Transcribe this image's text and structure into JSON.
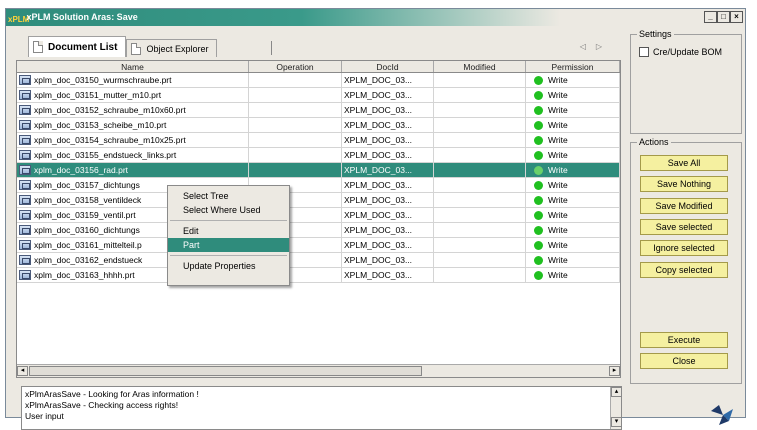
{
  "window": {
    "title": "xPLM Solution Aras: Save",
    "app_icon": "xPLM",
    "minimize": "_",
    "maximize": "□",
    "close": "×"
  },
  "tabs": [
    {
      "label": "Document List",
      "active": true
    },
    {
      "label": "Object Explorer",
      "active": false
    }
  ],
  "tab_nav": {
    "prev": "◁",
    "next": "▷"
  },
  "columns": [
    "Name",
    "Operation",
    "DocId",
    "Modified",
    "Permission"
  ],
  "rows": [
    {
      "name": "xplm_doc_03150_wurmschraube.prt",
      "operation": "",
      "docid": "XPLM_DOC_03...",
      "modified": "",
      "permission": "Write"
    },
    {
      "name": "xplm_doc_03151_mutter_m10.prt",
      "operation": "",
      "docid": "XPLM_DOC_03...",
      "modified": "",
      "permission": "Write"
    },
    {
      "name": "xplm_doc_03152_schraube_m10x60.prt",
      "operation": "",
      "docid": "XPLM_DOC_03...",
      "modified": "",
      "permission": "Write"
    },
    {
      "name": "xplm_doc_03153_scheibe_m10.prt",
      "operation": "",
      "docid": "XPLM_DOC_03...",
      "modified": "",
      "permission": "Write"
    },
    {
      "name": "xplm_doc_03154_schraube_m10x25.prt",
      "operation": "",
      "docid": "XPLM_DOC_03...",
      "modified": "",
      "permission": "Write"
    },
    {
      "name": "xplm_doc_03155_endstueck_links.prt",
      "operation": "",
      "docid": "XPLM_DOC_03...",
      "modified": "",
      "permission": "Write"
    },
    {
      "name": "xplm_doc_03156_rad.prt",
      "operation": "",
      "docid": "XPLM_DOC_03...",
      "modified": "",
      "permission": "Write",
      "selected": true
    },
    {
      "name": "xplm_doc_03157_dichtungs",
      "operation": "",
      "docid": "XPLM_DOC_03...",
      "modified": "",
      "permission": "Write"
    },
    {
      "name": "xplm_doc_03158_ventildeck",
      "operation": "",
      "docid": "XPLM_DOC_03...",
      "modified": "",
      "permission": "Write"
    },
    {
      "name": "xplm_doc_03159_ventil.prt",
      "operation": "",
      "docid": "XPLM_DOC_03...",
      "modified": "",
      "permission": "Write"
    },
    {
      "name": "xplm_doc_03160_dichtungs",
      "operation": "",
      "docid": "XPLM_DOC_03...",
      "modified": "",
      "permission": "Write"
    },
    {
      "name": "xplm_doc_03161_mittelteil.p",
      "operation": "",
      "docid": "XPLM_DOC_03...",
      "modified": "",
      "permission": "Write"
    },
    {
      "name": "xplm_doc_03162_endstueck",
      "operation": "",
      "docid": "XPLM_DOC_03...",
      "modified": "",
      "permission": "Write"
    },
    {
      "name": "xplm_doc_03163_hhhh.prt",
      "operation": "",
      "docid": "XPLM_DOC_03...",
      "modified": "",
      "permission": "Write"
    }
  ],
  "context_menu": {
    "items": [
      {
        "label": "Select Tree",
        "highlight": false
      },
      {
        "label": "Select Where Used",
        "highlight": false
      },
      {
        "sep": true
      },
      {
        "label": "Edit",
        "highlight": false
      },
      {
        "label": "Part",
        "highlight": true
      },
      {
        "sep": true
      },
      {
        "label": "Update Properties",
        "highlight": false
      }
    ]
  },
  "log": [
    "xPlmArasSave - Looking for Aras information !",
    "xPlmArasSave - Checking access rights!",
    "User input"
  ],
  "settings": {
    "legend": "Settings",
    "checkbox_label": "Cre/Update BOM",
    "checked": false
  },
  "actions": {
    "legend": "Actions",
    "buttons": [
      "Save All",
      "Save Nothing",
      "Save Modified",
      "Save selected",
      "Ignore selected",
      "Copy selected"
    ]
  },
  "execute_label": "Execute",
  "close_label": "Close",
  "scroll": {
    "left": "◂",
    "right": "▸",
    "up": "▴",
    "down": "▾"
  },
  "colors": {
    "accent": "#2f8c7c",
    "status_green": "#20c020",
    "button_yellow": "#f5f0a0"
  },
  "icons": {
    "file": "part-file-icon",
    "status": "green-dot-icon",
    "logo": "xplm-logo-icon"
  }
}
